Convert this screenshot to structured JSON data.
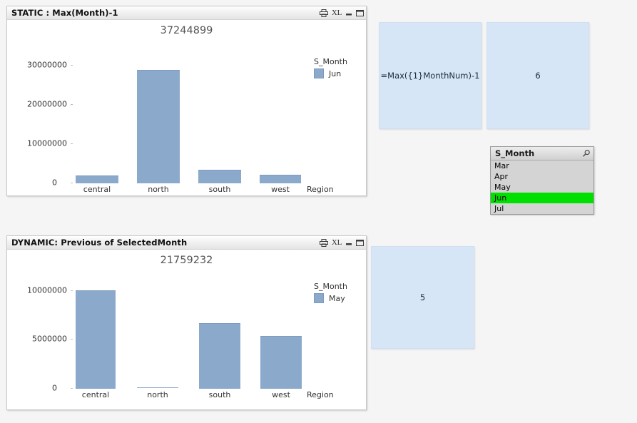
{
  "theme": {
    "page_bg": "#f5f5f5",
    "bar_color": "#8ba9ca",
    "textbox_bg": "#d7e6f7",
    "listbox_bg": "#d4d4d4",
    "selection_green": "#00e000"
  },
  "panels": {
    "static": {
      "title": "STATIC : Max(Month)-1",
      "buttons": {
        "print": "print-icon",
        "excel": "XL",
        "minimize": "minimize-icon",
        "maximize": "maximize-icon"
      }
    },
    "dynamic": {
      "title": "DYNAMIC: Previous of SelectedMonth",
      "buttons": {
        "print": "print-icon",
        "excel": "XL",
        "minimize": "minimize-icon",
        "maximize": "maximize-icon"
      }
    }
  },
  "chart_data": [
    {
      "id": "static-chart",
      "type": "bar",
      "title": "37244899",
      "categories": [
        "central",
        "north",
        "south",
        "west"
      ],
      "values": [
        1850000,
        28700000,
        3300000,
        1950000
      ],
      "series": [
        {
          "name": "Jun",
          "values": [
            1850000,
            28700000,
            3300000,
            1950000
          ]
        }
      ],
      "xlabel": "Region",
      "ylabel": "",
      "ylim": [
        0,
        33000000
      ],
      "yticks": [
        0,
        10000000,
        20000000,
        30000000
      ],
      "ytick_labels": [
        "0",
        "10000000",
        "20000000",
        "30000000"
      ],
      "grid": false,
      "legend": {
        "title": "S_Month",
        "position": "top-right",
        "entries": [
          "Jun"
        ]
      }
    },
    {
      "id": "dynamic-chart",
      "type": "bar",
      "title": "21759232",
      "categories": [
        "central",
        "north",
        "south",
        "west"
      ],
      "values": [
        9950000,
        60000,
        6600000,
        5250000
      ],
      "series": [
        {
          "name": "May",
          "values": [
            9950000,
            60000,
            6600000,
            5250000
          ]
        }
      ],
      "xlabel": "Region",
      "ylabel": "",
      "ylim": [
        0,
        11200000
      ],
      "yticks": [
        0,
        5000000,
        10000000
      ],
      "ytick_labels": [
        "0",
        "5000000",
        "10000000"
      ],
      "grid": false,
      "legend": {
        "title": "S_Month",
        "position": "top-right",
        "entries": [
          "May"
        ]
      }
    }
  ],
  "textboxes": {
    "expression": "=Max({1}MonthNum)-1",
    "static_result": "6",
    "dynamic_result": "5"
  },
  "listbox": {
    "title": "S_Month",
    "search_icon": "search-icon",
    "items": [
      {
        "label": "Mar",
        "selected": false
      },
      {
        "label": "Apr",
        "selected": false
      },
      {
        "label": "May",
        "selected": false
      },
      {
        "label": "Jun",
        "selected": true
      },
      {
        "label": "Jul",
        "selected": false
      }
    ]
  }
}
